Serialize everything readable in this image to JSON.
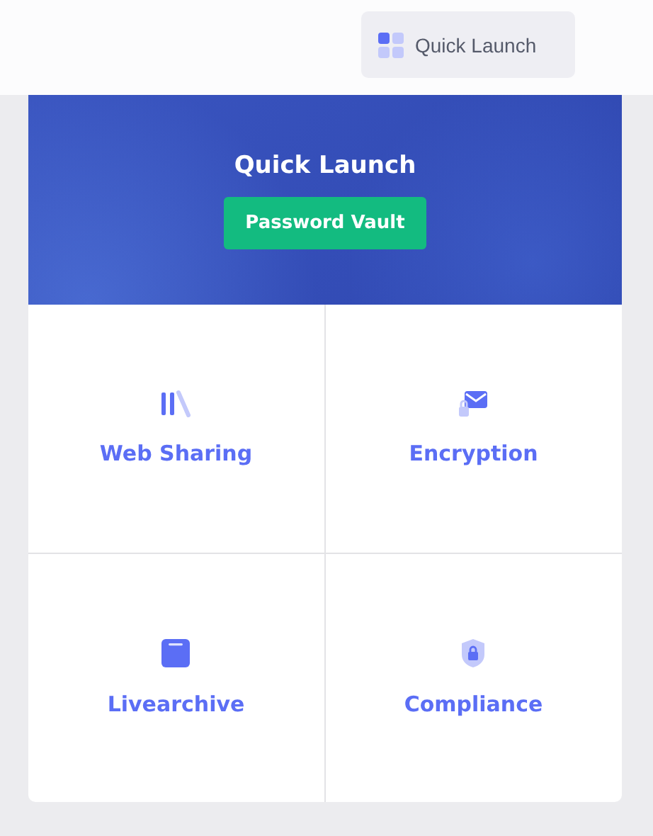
{
  "topbar": {
    "button": "Quick Launch"
  },
  "panel": {
    "title": "Quick Launch",
    "action": "Password Vault"
  },
  "tiles": [
    {
      "kind": "books",
      "label": "Web Sharing"
    },
    {
      "kind": "mail-lock",
      "label": "Encryption"
    },
    {
      "kind": "archive",
      "label": "Livearchive"
    },
    {
      "kind": "shield",
      "label": "Compliance"
    }
  ]
}
